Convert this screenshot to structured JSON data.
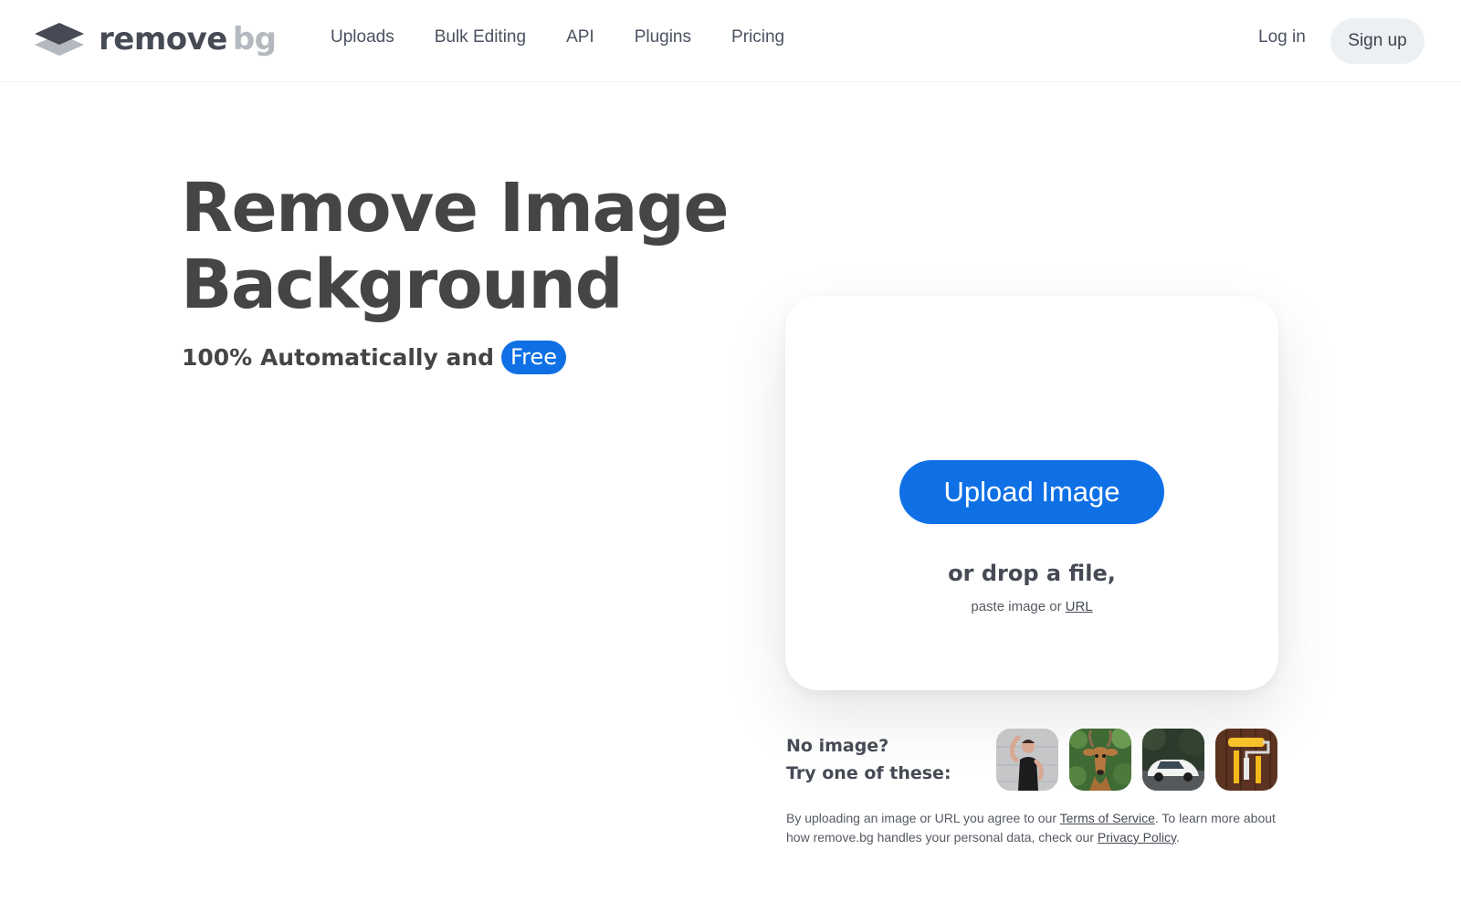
{
  "header": {
    "logo_part_1": "remove",
    "logo_part_2": "bg",
    "nav": [
      {
        "label": "Uploads"
      },
      {
        "label": "Bulk Editing"
      },
      {
        "label": "API"
      },
      {
        "label": "Plugins"
      },
      {
        "label": "Pricing"
      }
    ],
    "login_label": "Log in",
    "signup_label": "Sign up"
  },
  "hero": {
    "title_line_1": "Remove Image",
    "title_line_2": "Background",
    "subtitle": "100% Automatically and",
    "badge": "Free"
  },
  "upload": {
    "button_label": "Upload Image",
    "drop_text": "or drop a file,",
    "paste_text": "paste image or",
    "url_label": "URL"
  },
  "samples": {
    "line_1": "No image?",
    "line_2": "Try one of these:",
    "items": [
      {
        "icon": "person-sample-icon"
      },
      {
        "icon": "deer-sample-icon"
      },
      {
        "icon": "car-sample-icon"
      },
      {
        "icon": "paint-roller-sample-icon"
      }
    ]
  },
  "legal": {
    "part_1": "By uploading an image or URL you agree to our",
    "tos_label": "Terms of Service",
    "part_2": ". To learn more about how remove.bg handles your personal data, check our",
    "privacy_label": "Privacy Policy",
    "part_3": "."
  },
  "colors": {
    "accent": "#0f70e6",
    "text": "#454545",
    "logo_gray": "#b4b8bf"
  }
}
